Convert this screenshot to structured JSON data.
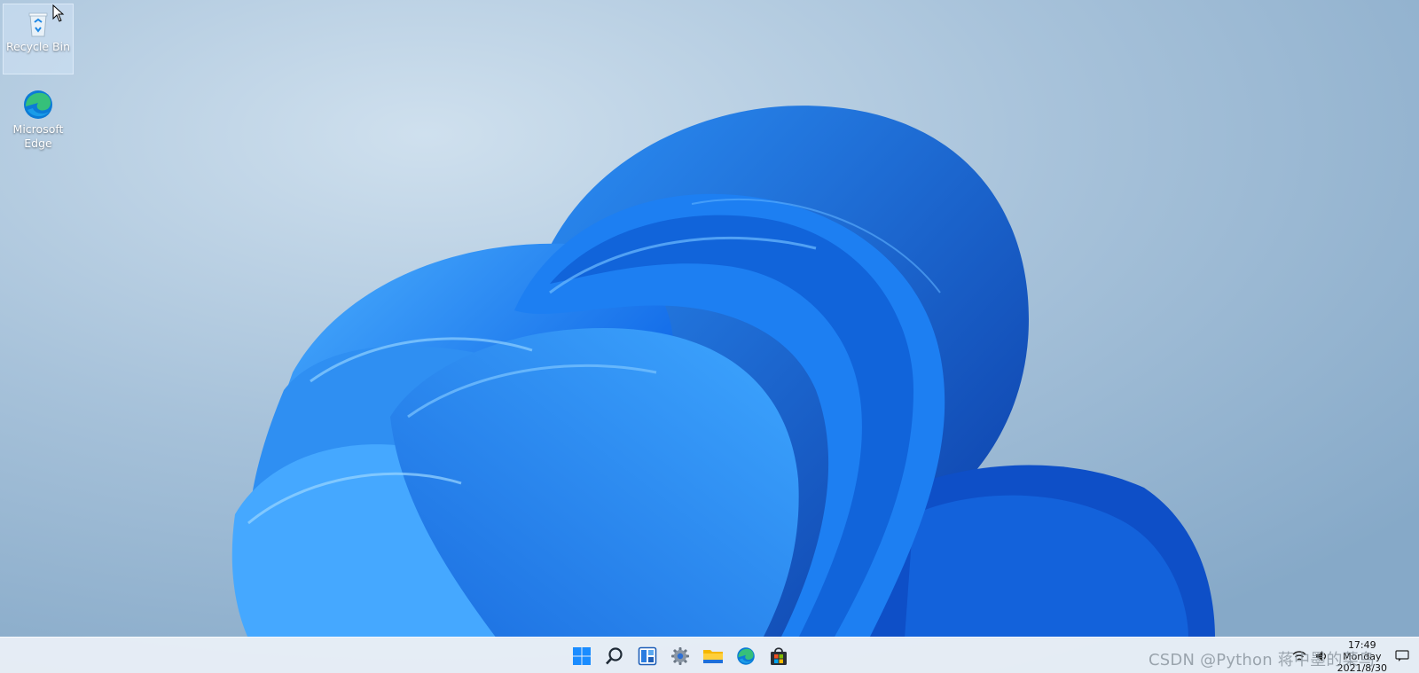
{
  "desktop": {
    "icons": [
      {
        "label": "Recycle Bin",
        "icon": "recycle-bin-icon"
      },
      {
        "label": "Microsoft\nEdge",
        "icon": "edge-icon"
      }
    ]
  },
  "taskbar": {
    "apps": [
      {
        "name": "Start",
        "icon": "windows-start-icon"
      },
      {
        "name": "Search",
        "icon": "search-icon"
      },
      {
        "name": "Widgets",
        "icon": "widgets-icon"
      },
      {
        "name": "Settings",
        "icon": "gear-icon"
      },
      {
        "name": "File Explorer",
        "icon": "folder-icon"
      },
      {
        "name": "Microsoft Edge",
        "icon": "edge-icon"
      },
      {
        "name": "Microsoft Store",
        "icon": "store-icon"
      }
    ],
    "tray": {
      "time": "17:49",
      "day": "Monday",
      "date": "2021/8/30"
    }
  },
  "watermark": "CSDN @Python 蒋中墨的菜鸟",
  "colors": {
    "accent": "#1a73e8",
    "bloom_light": "#3aa0ff",
    "bloom_dark": "#0a3fb0",
    "taskbar_bg": "#ecf1f8"
  }
}
